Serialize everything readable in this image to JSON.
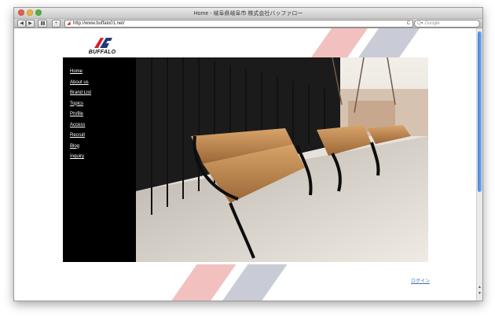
{
  "window": {
    "title": "Home - 岐阜県岐阜市 株式会社バッファロー",
    "back_label": "◀",
    "forward_label": "▶",
    "add_bookmark_label": "+",
    "url": "http://www.buffalo01.net/",
    "search_placeholder": "Google",
    "reload_label": "C"
  },
  "site": {
    "logo_text": "BUFFALO",
    "nav": [
      "Home",
      "About us",
      "Brand List",
      "Topics",
      "Profile",
      "Access",
      "Recruit",
      "Blog",
      "Inquiry"
    ],
    "login_label": "ログイン"
  },
  "colors": {
    "accent_pink": "#f3c0c0",
    "accent_gray": "#c9ccd6",
    "logo_red": "#d42027",
    "logo_navy": "#1f3a7a",
    "link_blue": "#3b6fb6"
  }
}
